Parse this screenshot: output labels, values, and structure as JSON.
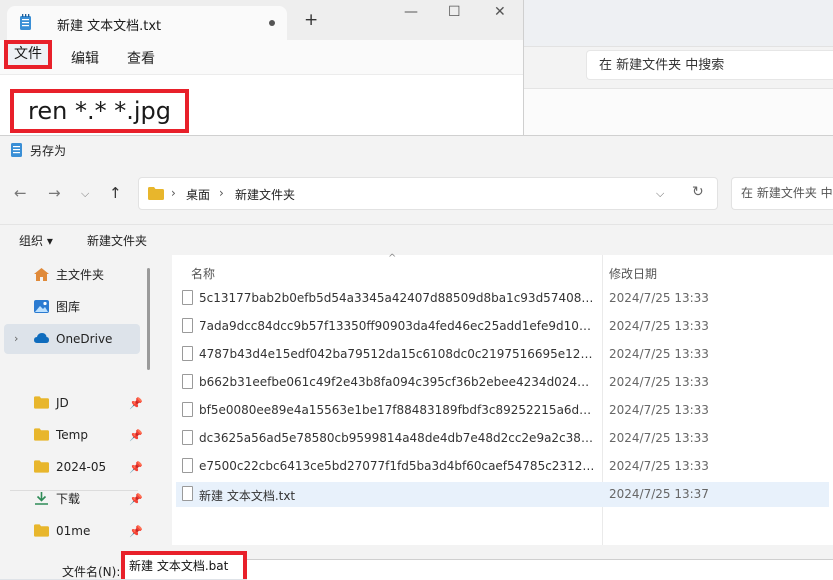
{
  "background_window": {
    "search_placeholder": "在 新建文件夹 中搜索"
  },
  "notepad": {
    "tab_title": "新建 文本文档.txt",
    "new_tab": "+",
    "window_controls": {
      "minimize": "—",
      "maximize": "☐",
      "close": "✕"
    },
    "menu": {
      "file": "文件",
      "edit": "编辑",
      "view": "查看"
    },
    "content": "ren *.* *.jpg"
  },
  "dialog": {
    "title": "另存为",
    "breadcrumb": [
      "桌面",
      "新建文件夹"
    ],
    "search_placeholder": "在 新建文件夹 中搜",
    "toolbar": {
      "organize": "组织 ▾",
      "new_folder": "新建文件夹"
    },
    "sidebar": [
      {
        "label": "主文件夹",
        "icon": "home-icon"
      },
      {
        "label": "图库",
        "icon": "gallery-icon"
      },
      {
        "label": "OneDrive",
        "icon": "cloud-icon"
      },
      {
        "label": "JD",
        "icon": "folder-icon",
        "pinned": true
      },
      {
        "label": "Temp",
        "icon": "folder-icon",
        "pinned": true
      },
      {
        "label": "2024-05",
        "icon": "folder-icon",
        "pinned": true
      },
      {
        "label": "下载",
        "icon": "download-icon",
        "pinned": true
      },
      {
        "label": "01me",
        "icon": "folder-icon",
        "pinned": true
      }
    ],
    "columns": {
      "name": "名称",
      "modified": "修改日期"
    },
    "files": [
      {
        "name": "5c13177bab2b0efb5d54a3345a42407d88509d8ba1c93d57408d64f...",
        "date": "2024/7/25 13:33"
      },
      {
        "name": "7ada9dcc84dcc9b57f13350ff90903da4fed46ec25add1efe9d103d0...",
        "date": "2024/7/25 13:33"
      },
      {
        "name": "4787b43d4e15edf042ba79512da15c6108dc0c2197516695e12634d...",
        "date": "2024/7/25 13:33"
      },
      {
        "name": "b662b31eefbe061c49f2e43b8fa094c395cf36b2ebee4234d024d135...",
        "date": "2024/7/25 13:33"
      },
      {
        "name": "bf5e0080ee89e4a15563e1be17f88483189fbdf3c89252215a6d5676...",
        "date": "2024/7/25 13:33"
      },
      {
        "name": "dc3625a56ad5e78580cb9599814a48de4db7e48d2cc2e9a2c384c29...",
        "date": "2024/7/25 13:33"
      },
      {
        "name": "e7500c22cbc6413ce5bd27077f1fd5ba3d4bf60caef54785c231223b...",
        "date": "2024/7/25 13:33"
      },
      {
        "name": "新建 文本文档.txt",
        "date": "2024/7/25 13:37"
      }
    ],
    "filename_label": "文件名(N):",
    "filename_value": "新建 文本文档.bat"
  },
  "colors": {
    "highlight": "#e8202a",
    "selection": "#e8f1fb",
    "onedrive": "#0f6cbd",
    "folder": "#e8b62c"
  }
}
